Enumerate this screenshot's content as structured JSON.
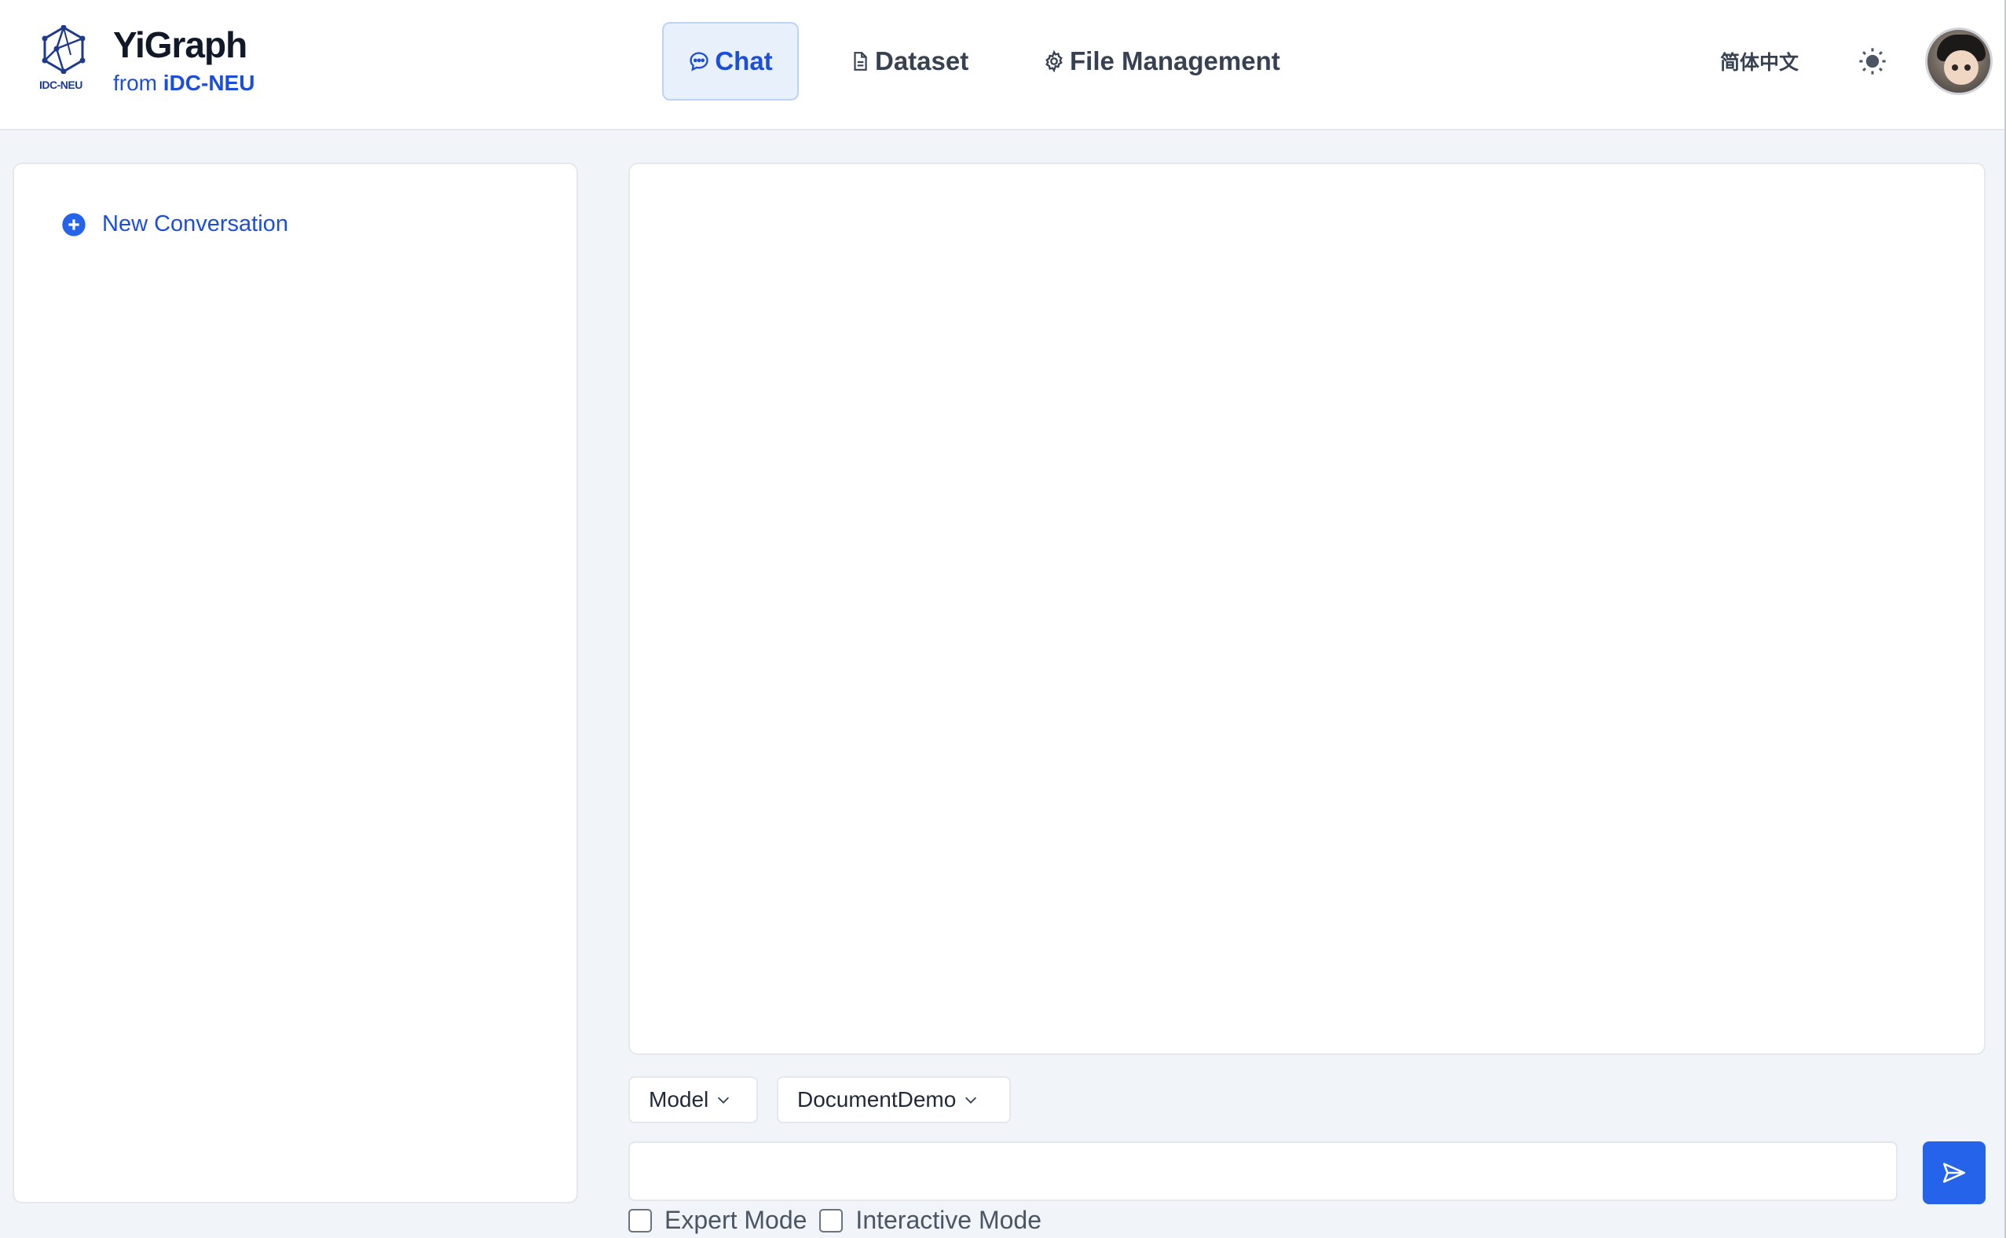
{
  "brand": {
    "logo_text": "IDC-NEU",
    "title": "YiGraph",
    "subtitle_prefix": "from",
    "subtitle_org": "iDC-NEU"
  },
  "nav": {
    "tabs": [
      {
        "label": "Chat",
        "icon": "chat-bubble-icon",
        "active": true
      },
      {
        "label": "Dataset",
        "icon": "document-icon",
        "active": false
      },
      {
        "label": "File Management",
        "icon": "gear-icon",
        "active": false
      }
    ]
  },
  "header_right": {
    "language_label": "简体中文",
    "theme_icon": "sun-icon",
    "avatar_icon": "user-avatar"
  },
  "sidebar": {
    "new_conversation_label": "New Conversation",
    "new_conversation_icon": "plus-circle-icon"
  },
  "composer": {
    "model_select_label": "Model",
    "dataset_select_label": "DocumentDemo",
    "input_value": "",
    "send_icon": "send-icon",
    "modes": [
      {
        "label": "Expert Mode",
        "checked": false
      },
      {
        "label": "Interactive Mode",
        "checked": false
      }
    ]
  },
  "colors": {
    "accent": "#2563eb",
    "accent_text": "#1d4ed8",
    "active_tab_bg": "#e8f0fc",
    "page_bg": "#f1f4f8"
  }
}
